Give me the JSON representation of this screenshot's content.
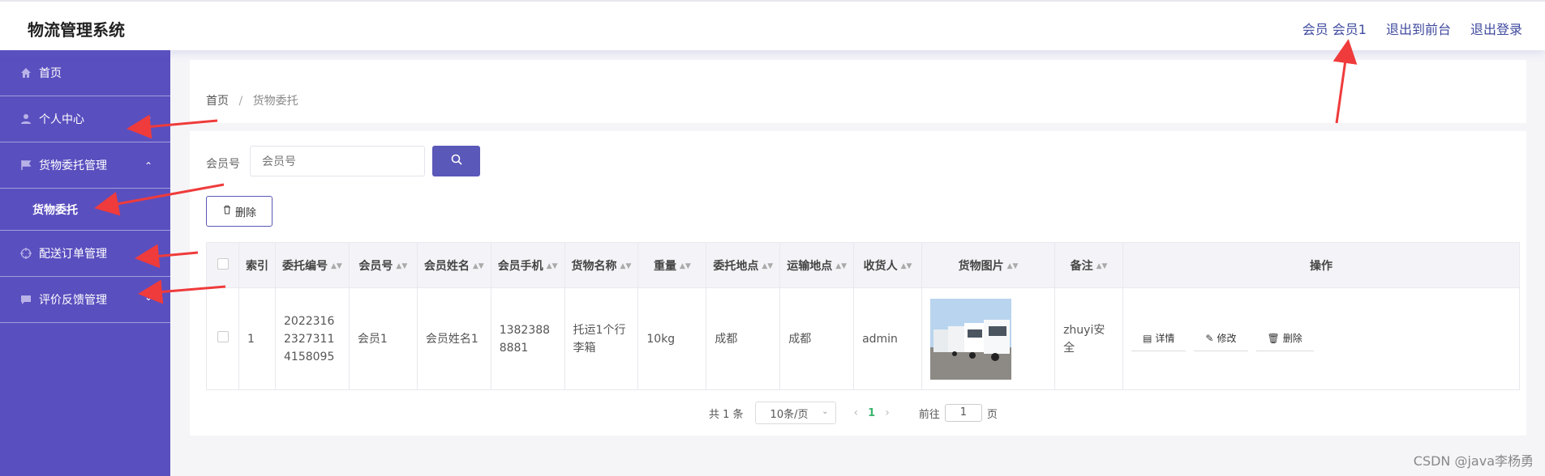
{
  "app_title": "物流管理系统",
  "top_links": {
    "user": "会员 会员1",
    "front": "退出到前台",
    "logout": "退出登录"
  },
  "sidebar": {
    "items": [
      {
        "label": "首页",
        "icon": "home-icon"
      },
      {
        "label": "个人中心",
        "icon": "user-icon"
      },
      {
        "label": "货物委托管理",
        "icon": "flag-icon"
      },
      {
        "label": "货物委托",
        "icon": ""
      },
      {
        "label": "配送订单管理",
        "icon": "target-icon"
      },
      {
        "label": "评价反馈管理",
        "icon": "chat-icon"
      }
    ]
  },
  "breadcrumb": {
    "home": "首页",
    "sep": "/",
    "current": "货物委托"
  },
  "search": {
    "label": "会员号",
    "placeholder": "会员号"
  },
  "actions": {
    "delete": "删除"
  },
  "table": {
    "headers": [
      "索引",
      "委托编号",
      "会员号",
      "会员姓名",
      "会员手机",
      "货物名称",
      "重量",
      "委托地点",
      "运输地点",
      "收货人",
      "货物图片",
      "备注",
      "操作"
    ],
    "rows": [
      {
        "index": "1",
        "order_no": "202231623273114158095",
        "member_no": "会员1",
        "member_name": "会员姓名1",
        "phone": "13823888881",
        "cargo": "托运1个行李箱",
        "weight": "10kg",
        "from": "成都",
        "to": "成都",
        "receiver": "admin",
        "remark": "zhuyi安全",
        "ops": {
          "detail": "详情",
          "edit": "修改",
          "delete": "删除"
        }
      }
    ]
  },
  "pagination": {
    "total": "共 1 条",
    "page_size": "10条/页",
    "current_page": "1",
    "goto_label": "前往",
    "goto_value": "1",
    "page_unit": "页"
  },
  "watermark": "CSDN @java李杨勇",
  "colors": {
    "sidebar": "#5a4fbf",
    "accent": "#5a58b8",
    "annotation": "#ef3b3b"
  }
}
